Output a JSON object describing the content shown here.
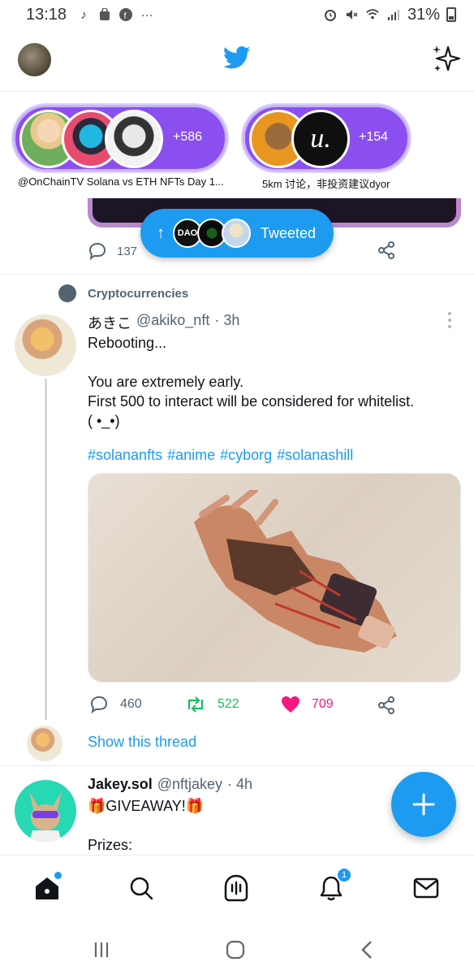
{
  "statusbar": {
    "time": "13:18",
    "battery": "31%",
    "icons_left": [
      "tiktok-icon",
      "shopping-icon",
      "facebook-icon",
      "more-dots-icon"
    ],
    "icons_right": [
      "alarm-icon",
      "mute-icon",
      "wifi-icon",
      "signal-icon",
      "battery-icon"
    ]
  },
  "spaces": [
    {
      "count": "+586",
      "caption": "@OnChainTV Solana vs ETH NFTs Day 1..."
    },
    {
      "count": "+154",
      "caption": "5km 讨论，非投资建议dyor"
    }
  ],
  "prev_tweet": {
    "reply_count": "137"
  },
  "tweeted_pill": {
    "label": "Tweeted",
    "first_avatar_text": "DAO"
  },
  "tweet": {
    "topic": "Cryptocurrencies",
    "name": "あきこ",
    "handle": "@akiko_nft",
    "time": "· 3h",
    "lines": [
      "Rebooting...",
      "",
      "You are extremely early.",
      "First 500 to interact will be considered for whitelist.",
      "( •_•)"
    ],
    "hashtags": [
      "#solananfts",
      "#anime",
      "#cyborg",
      "#solanashill"
    ],
    "reply_count": "460",
    "retweet_count": "522",
    "like_count": "709",
    "show_thread": "Show this thread"
  },
  "next_tweet": {
    "name": "Jakey.sol",
    "handle": "@nftjakey",
    "time": "· 4h",
    "lines": [
      "🎁GIVEAWAY!🎁",
      "",
      "Prizes:"
    ]
  },
  "bottom_nav": {
    "items": [
      "home-icon",
      "search-icon",
      "spaces-icon",
      "notifications-icon",
      "messages-icon"
    ],
    "notifications_badge": "1"
  },
  "colors": {
    "accent": "#1d9bf0",
    "retweet": "#17bf63",
    "like": "#f91880",
    "spaces_purple": "#8b4ff0"
  }
}
